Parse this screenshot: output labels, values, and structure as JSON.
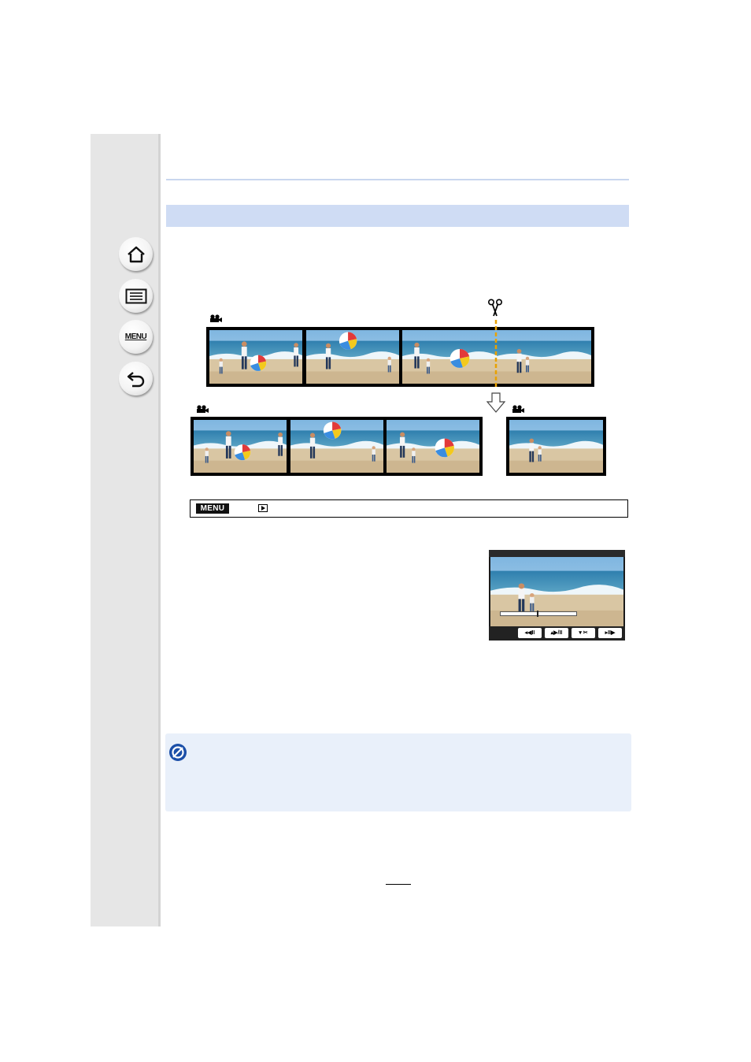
{
  "sidebar": {
    "home_icon": "home-icon",
    "contents_icon": "contents-list-icon",
    "menu_label": "MENU",
    "back_icon": "return-icon"
  },
  "menu_path": {
    "badge": "MENU",
    "icon": "playback-icon"
  },
  "diagram": {
    "split_icon": "scissors-icon",
    "arrow_icon": "down-arrow-icon",
    "movie_icon": "motion-picture-icon"
  },
  "camera_screen": {
    "controls": [
      "◂◀II",
      "▴▶/II",
      "▾ ✂",
      "▸II▶"
    ]
  },
  "note": {
    "icon": "not-available-icon"
  },
  "colors": {
    "section_bar": "#cfdcf4",
    "note_background": "#e9f0fa",
    "note_icon": "#1b4fa8",
    "split_line": "#e8a100"
  }
}
